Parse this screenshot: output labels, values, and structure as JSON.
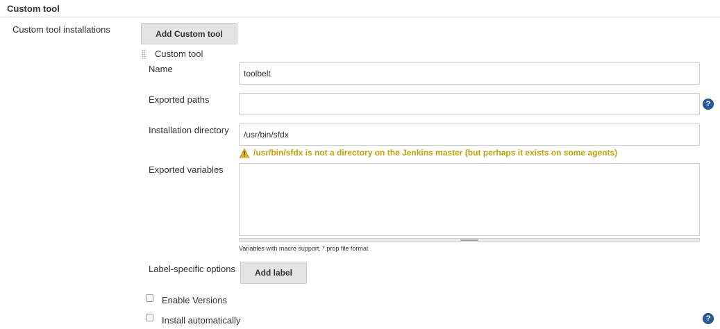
{
  "section": {
    "title": "Custom tool"
  },
  "installations": {
    "label": "Custom tool installations",
    "add_button": "Add Custom tool"
  },
  "tool": {
    "header": "Custom tool",
    "name": {
      "label": "Name",
      "value": "toolbelt"
    },
    "exported_paths": {
      "label": "Exported paths",
      "value": ""
    },
    "installation_directory": {
      "label": "Installation directory",
      "value": "/usr/bin/sfdx",
      "warning": "/usr/bin/sfdx is not a directory on the Jenkins master (but perhaps it exists on some agents)"
    },
    "exported_variables": {
      "label": "Exported variables",
      "value": "",
      "hint": "Variables with macro support. *.prop file format"
    },
    "label_specific": {
      "label": "Label-specific options",
      "add_label_button": "Add label"
    },
    "enable_versions": {
      "label": "Enable Versions",
      "checked": false
    },
    "install_automatically": {
      "label": "Install automatically",
      "checked": false
    }
  },
  "icons": {
    "help": "help-icon",
    "warning": "warning-icon",
    "drag_handle": "drag-handle-icon"
  },
  "colors": {
    "warning": "#c4a000",
    "help_icon": "#2a5d9c",
    "button_bg": "#e4e4e4",
    "border": "#cccccc"
  }
}
